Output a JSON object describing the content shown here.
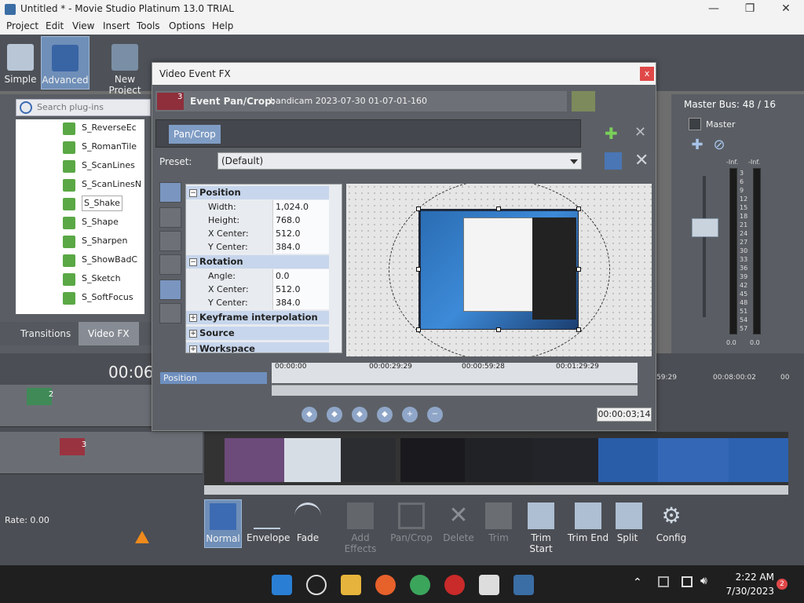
{
  "window": {
    "title": "Untitled * - Movie Studio Platinum 13.0 TRIAL",
    "min": "—",
    "max": "❐",
    "close": "✕"
  },
  "menu": [
    "Project",
    "Edit",
    "View",
    "Insert",
    "Tools",
    "Options",
    "Help"
  ],
  "toolbar": {
    "simple": "Simple",
    "advanced": "Advanced",
    "new_project": "New Project"
  },
  "explorer": {
    "search_placeholder": "Search plug-ins",
    "items": [
      "S_ReverseEc",
      "S_RomanTile",
      "S_ScanLines",
      "S_ScanLinesN",
      "S_Shake",
      "S_Shape",
      "S_Sharpen",
      "S_ShowBadC",
      "S_Sketch",
      "S_SoftFocus"
    ],
    "selected": "S_Shake",
    "tabs": [
      "Transitions",
      "Video FX"
    ]
  },
  "master_bus": {
    "title": "Master Bus: 48 / 16",
    "label": "Master",
    "left_peak": "-Inf.",
    "right_peak": "-Inf.",
    "scale": [
      "3",
      "6",
      "9",
      "12",
      "15",
      "18",
      "21",
      "24",
      "27",
      "30",
      "33",
      "36",
      "39",
      "42",
      "45",
      "48",
      "51",
      "54",
      "57"
    ],
    "left_value": "0.0",
    "right_value": "0.0"
  },
  "dialog": {
    "title": "Video Event FX",
    "close": "x",
    "event_label": "Event Pan/Crop:",
    "event_name": "bandicam 2023-07-30 01-07-01-160",
    "event_badge": "3",
    "chain_chip": "Pan/Crop",
    "preset_label": "Preset:",
    "preset_value": "(Default)",
    "properties": {
      "position": {
        "title": "Position",
        "width_k": "Width:",
        "width_v": "1,024.0",
        "height_k": "Height:",
        "height_v": "768.0",
        "xc_k": "X Center:",
        "xc_v": "512.0",
        "yc_k": "Y Center:",
        "yc_v": "384.0"
      },
      "rotation": {
        "title": "Rotation",
        "angle_k": "Angle:",
        "angle_v": "0.0",
        "xc_k": "X Center:",
        "xc_v": "512.0",
        "yc_k": "Y Center:",
        "yc_v": "384.0"
      },
      "keyframe": "Keyframe interpolation",
      "source": "Source",
      "workspace": "Workspace"
    },
    "keyframe_label": "Position",
    "ruler": [
      "00:00:00",
      "00:00:29:29",
      "00:00:59:28",
      "00:01:29:29"
    ],
    "time_display": "00:00:03;14"
  },
  "timeline": {
    "time_big": "00:06:",
    "ruler": [
      "59:29",
      "00:08:00:02",
      "00"
    ],
    "track2_badge": "2",
    "track3_badge": "3",
    "rate": "Rate: 0.00"
  },
  "tools": [
    "Normal",
    "Envelope",
    "Fade",
    "Add Effects",
    "Pan/Crop",
    "Delete",
    "Trim",
    "Trim Start",
    "Trim End",
    "Split",
    "Config"
  ],
  "taskbar": {
    "time": "2:22 AM",
    "date": "7/30/2023",
    "badge": "2"
  },
  "colors": {
    "accent": "#6f8fb8",
    "panel": "#5a5e64",
    "dialog": "#5c6066",
    "selection": "#c7d6ec"
  }
}
